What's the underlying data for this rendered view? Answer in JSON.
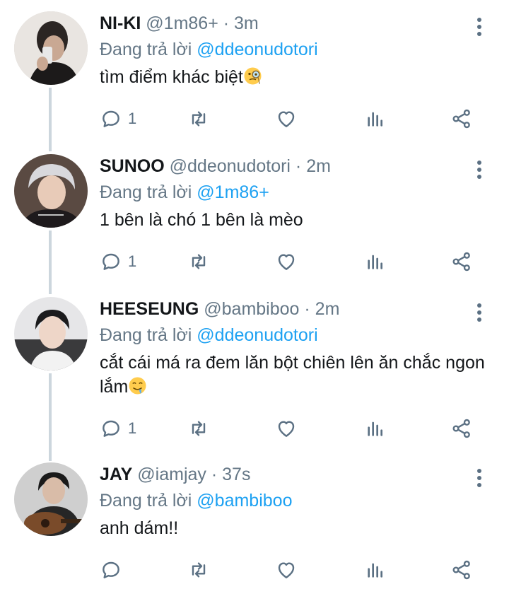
{
  "reply_prefix": "Đang trả lời",
  "colors": {
    "link": "#1da1f2",
    "muted": "#657786",
    "icon": "#5b7083",
    "thread_line": "#ccd6dd"
  },
  "tweets": [
    {
      "name": "NI-KI",
      "meta": "@1m86+ · 3m",
      "reply_to": "@ddeonudotori",
      "text": "tìm điểm khác biệt",
      "emoji": "monocle-face",
      "reply_count": "1"
    },
    {
      "name": "SUNOO",
      "meta": "@ddeonudotori · 2m",
      "reply_to": "@1m86+",
      "text": "1 bên là chó 1 bên là mèo",
      "emoji": "",
      "reply_count": "1"
    },
    {
      "name": "HEESEUNG",
      "meta": "@bambiboo · 2m",
      "reply_to": "@ddeonudotori",
      "text": "cắt cái má ra đem lăn bột chiên lên ăn chắc ngon lắm",
      "emoji": "drooling-face",
      "reply_count": "1"
    },
    {
      "name": "JAY",
      "meta": "@iamjay · 37s",
      "reply_to": "@bambiboo",
      "text": "anh dám!!",
      "emoji": "",
      "reply_count": ""
    }
  ]
}
